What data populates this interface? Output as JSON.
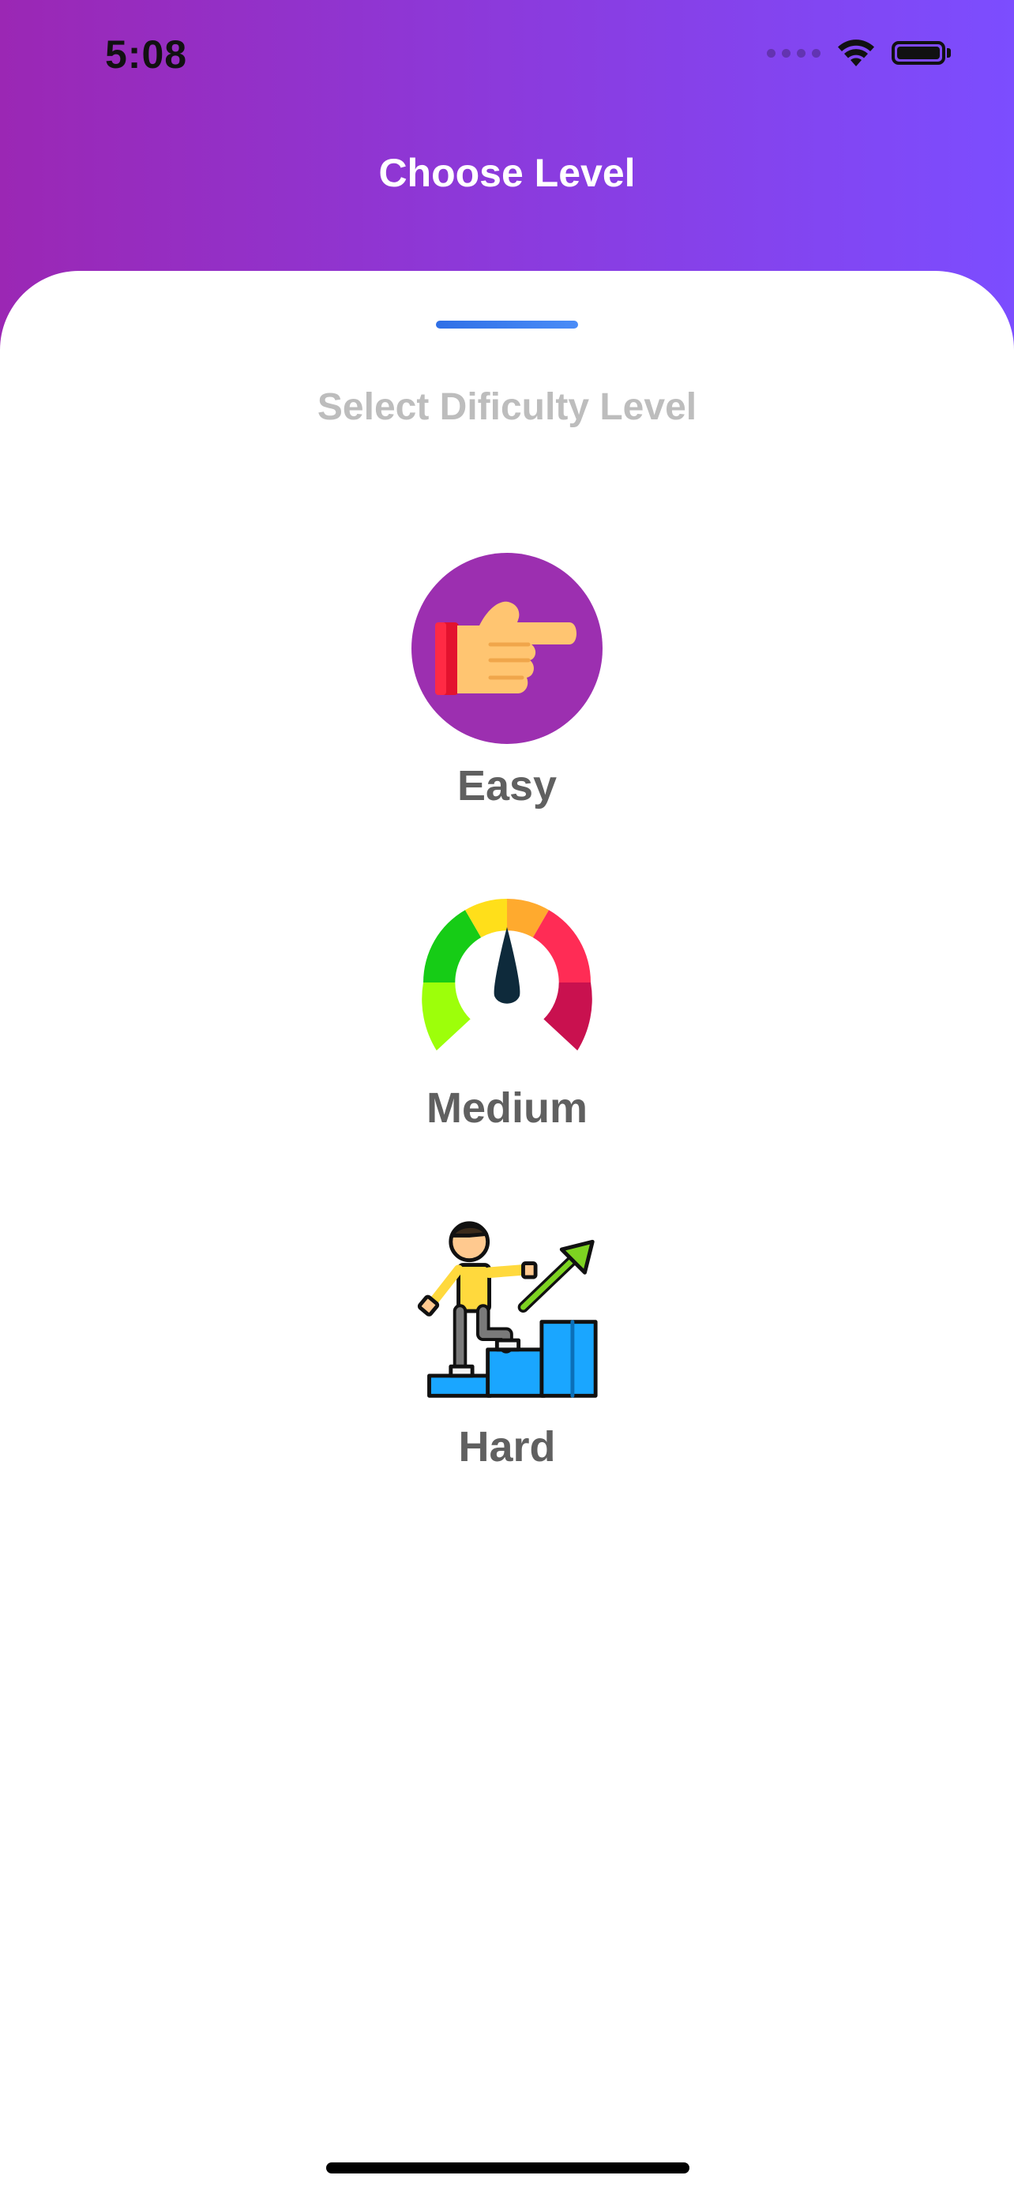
{
  "status_bar": {
    "time": "5:08",
    "icons": [
      "cellular-signal-icon",
      "wifi-icon",
      "battery-icon"
    ]
  },
  "header": {
    "title": "Choose Level",
    "gradient_colors": [
      "#9b27b4",
      "#7c4dff"
    ]
  },
  "sheet": {
    "subtitle": "Select Dificulty Level",
    "handle_color": "#2f6fe6"
  },
  "levels": [
    {
      "label": "Easy",
      "icon": "pointing-hand-icon"
    },
    {
      "label": "Medium",
      "icon": "speedometer-gauge-icon"
    },
    {
      "label": "Hard",
      "icon": "climbing-steps-icon"
    }
  ]
}
